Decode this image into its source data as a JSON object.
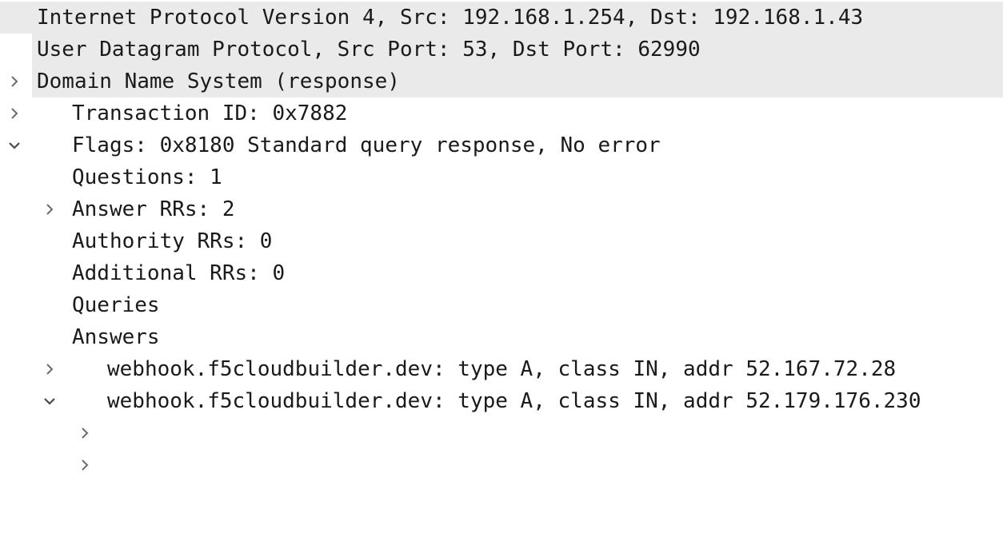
{
  "packet_details": {
    "ipv4": {
      "text": "Internet Protocol Version 4, Src: 192.168.1.254, Dst: 192.168.1.43",
      "expanded": false
    },
    "udp": {
      "text": "User Datagram Protocol, Src Port: 53, Dst Port: 62990",
      "expanded": false
    },
    "dns": {
      "text": "Domain Name System (response)",
      "expanded": true,
      "transaction_id": "Transaction ID: 0x7882",
      "flags": {
        "text": "Flags: 0x8180 Standard query response, No error",
        "expanded": false
      },
      "questions": "Questions: 1",
      "answer_rrs": "Answer RRs: 2",
      "authority_rrs": "Authority RRs: 0",
      "additional_rrs": "Additional RRs: 0",
      "queries": {
        "text": "Queries",
        "expanded": false
      },
      "answers": {
        "text": "Answers",
        "expanded": true,
        "items": [
          {
            "text": "webhook.f5cloudbuilder.dev: type A, class IN, addr 52.167.72.28",
            "expanded": false
          },
          {
            "text": "webhook.f5cloudbuilder.dev: type A, class IN, addr 52.179.176.230",
            "expanded": false
          }
        ]
      }
    }
  },
  "colors": {
    "protocol_row_bg": "#eaeaea",
    "text": "#1a1a1a",
    "chevron": "#6b6b6b"
  }
}
